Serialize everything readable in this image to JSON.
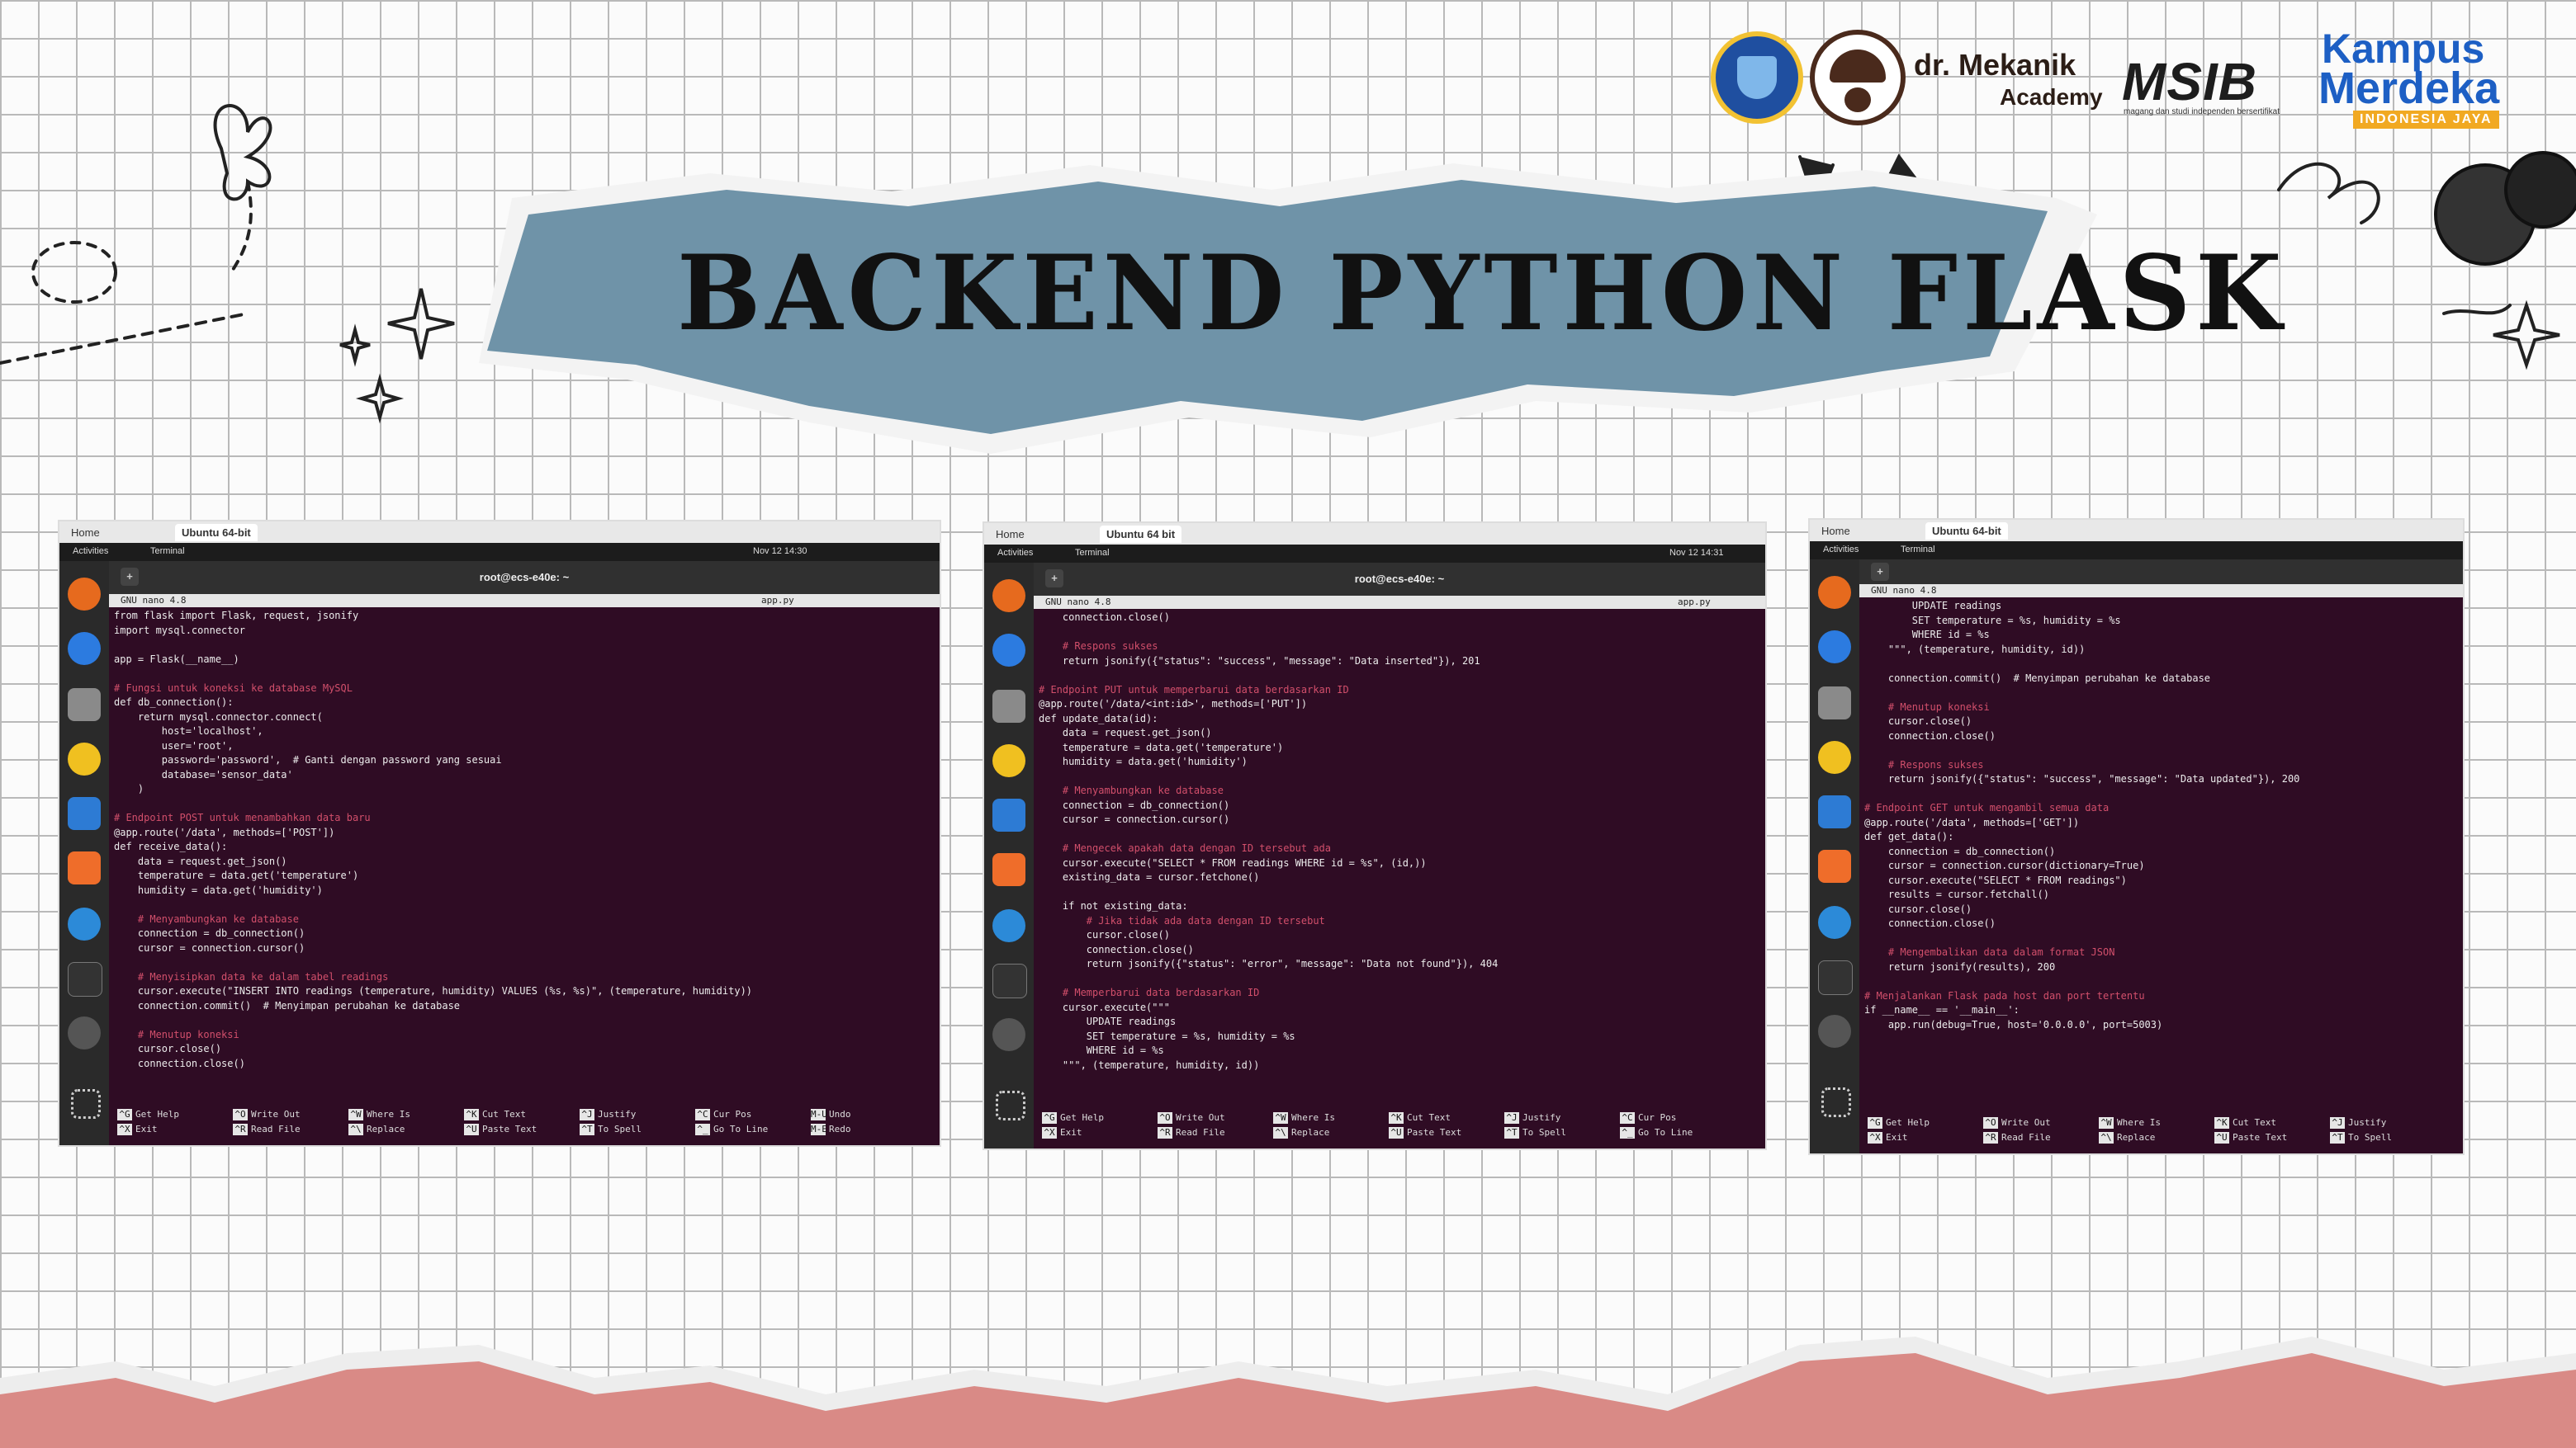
{
  "header": {
    "logos": {
      "mekanik_name": "dr. Mekanik",
      "mekanik_sub": "Academy",
      "msib": "MSIB",
      "msib_sub": "magang dan studi independen bersertifikat",
      "kampus": "Kampus",
      "merdeka": "Merdeka",
      "indonesia": "INDONESIA JAYA"
    },
    "title": "Backend Python Flask"
  },
  "colors": {
    "grid": "#b9b9b9",
    "banner": "#6f93a8",
    "bottom_paper": "#d98a86",
    "terminal_bg": "#2f0c24",
    "comment": "#d24f6b"
  },
  "screenshots": [
    {
      "tabs": [
        "Home",
        "Ubuntu 64-bit"
      ],
      "activities": "Activities",
      "terminal_label": "Terminal",
      "clock": "Nov 12  14:30",
      "window_title": "root@ecs-e40e: ~",
      "nano_version": "GNU nano 4.8",
      "file_name": "app.py",
      "code": [
        "from flask import Flask, request, jsonify",
        "import mysql.connector",
        "",
        "app = Flask(__name__)",
        "",
        "# Fungsi untuk koneksi ke database MySQL",
        "def db_connection():",
        "    return mysql.connector.connect(",
        "        host='localhost',",
        "        user='root',",
        "        password='password',  # Ganti dengan password yang sesuai",
        "        database='sensor_data'",
        "    )",
        "",
        "# Endpoint POST untuk menambahkan data baru",
        "@app.route('/data', methods=['POST'])",
        "def receive_data():",
        "    data = request.get_json()",
        "    temperature = data.get('temperature')",
        "    humidity = data.get('humidity')",
        "",
        "    # Menyambungkan ke database",
        "    connection = db_connection()",
        "    cursor = connection.cursor()",
        "",
        "    # Menyisipkan data ke dalam tabel readings",
        "    cursor.execute(\"INSERT INTO readings (temperature, humidity) VALUES (%s, %s)\", (temperature, humidity))",
        "    connection.commit()  # Menyimpan perubahan ke database",
        "",
        "    # Menutup koneksi",
        "    cursor.close()",
        "    connection.close()"
      ],
      "shortcuts": [
        [
          "^G",
          "Get Help",
          "^X",
          "Exit"
        ],
        [
          "^O",
          "Write Out",
          "^R",
          "Read File"
        ],
        [
          "^W",
          "Where Is",
          "^\\",
          "Replace"
        ],
        [
          "^K",
          "Cut Text",
          "^U",
          "Paste Text"
        ],
        [
          "^J",
          "Justify",
          "^T",
          "To Spell"
        ],
        [
          "^C",
          "Cur Pos",
          "^_",
          "Go To Line"
        ],
        [
          "M-U",
          "Undo",
          "M-E",
          "Redo"
        ]
      ]
    },
    {
      "tabs": [
        "Home",
        "Ubuntu 64 bit"
      ],
      "activities": "Activities",
      "terminal_label": "Terminal",
      "clock": "Nov 12  14:31",
      "window_title": "root@ecs-e40e: ~",
      "nano_version": "GNU nano 4.8",
      "file_name": "app.py",
      "code": [
        "    connection.close()",
        "",
        "    # Respons sukses",
        "    return jsonify({\"status\": \"success\", \"message\": \"Data inserted\"}), 201",
        "",
        "# Endpoint PUT untuk memperbarui data berdasarkan ID",
        "@app.route('/data/<int:id>', methods=['PUT'])",
        "def update_data(id):",
        "    data = request.get_json()",
        "    temperature = data.get('temperature')",
        "    humidity = data.get('humidity')",
        "",
        "    # Menyambungkan ke database",
        "    connection = db_connection()",
        "    cursor = connection.cursor()",
        "",
        "    # Mengecek apakah data dengan ID tersebut ada",
        "    cursor.execute(\"SELECT * FROM readings WHERE id = %s\", (id,))",
        "    existing_data = cursor.fetchone()",
        "",
        "    if not existing_data:",
        "        # Jika tidak ada data dengan ID tersebut",
        "        cursor.close()",
        "        connection.close()",
        "        return jsonify({\"status\": \"error\", \"message\": \"Data not found\"}), 404",
        "",
        "    # Memperbarui data berdasarkan ID",
        "    cursor.execute(\"\"\"",
        "        UPDATE readings",
        "        SET temperature = %s, humidity = %s",
        "        WHERE id = %s",
        "    \"\"\", (temperature, humidity, id))"
      ],
      "shortcuts": [
        [
          "^G",
          "Get Help",
          "^X",
          "Exit"
        ],
        [
          "^O",
          "Write Out",
          "^R",
          "Read File"
        ],
        [
          "^W",
          "Where Is",
          "^\\",
          "Replace"
        ],
        [
          "^K",
          "Cut Text",
          "^U",
          "Paste Text"
        ],
        [
          "^J",
          "Justify",
          "^T",
          "To Spell"
        ],
        [
          "^C",
          "Cur Pos",
          "^_",
          "Go To Line"
        ]
      ]
    },
    {
      "tabs": [
        "Home",
        "Ubuntu 64-bit"
      ],
      "activities": "Activities",
      "terminal_label": "Terminal",
      "clock": "",
      "window_title": "",
      "nano_version": "GNU nano 4.8",
      "file_name": "",
      "code": [
        "        UPDATE readings",
        "        SET temperature = %s, humidity = %s",
        "        WHERE id = %s",
        "    \"\"\", (temperature, humidity, id))",
        "",
        "    connection.commit()  # Menyimpan perubahan ke database",
        "",
        "    # Menutup koneksi",
        "    cursor.close()",
        "    connection.close()",
        "",
        "    # Respons sukses",
        "    return jsonify({\"status\": \"success\", \"message\": \"Data updated\"}), 200",
        "",
        "# Endpoint GET untuk mengambil semua data",
        "@app.route('/data', methods=['GET'])",
        "def get_data():",
        "    connection = db_connection()",
        "    cursor = connection.cursor(dictionary=True)",
        "    cursor.execute(\"SELECT * FROM readings\")",
        "    results = cursor.fetchall()",
        "    cursor.close()",
        "    connection.close()",
        "",
        "    # Mengembalikan data dalam format JSON",
        "    return jsonify(results), 200",
        "",
        "# Menjalankan Flask pada host dan port tertentu",
        "if __name__ == '__main__':",
        "    app.run(debug=True, host='0.0.0.0', port=5003)"
      ],
      "shortcuts": [
        [
          "^G",
          "Get Help",
          "^X",
          "Exit"
        ],
        [
          "^O",
          "Write Out",
          "^R",
          "Read File"
        ],
        [
          "^W",
          "Where Is",
          "^\\",
          "Replace"
        ],
        [
          "^K",
          "Cut Text",
          "^U",
          "Paste Text"
        ],
        [
          "^J",
          "Justify",
          "^T",
          "To Spell"
        ]
      ]
    }
  ]
}
